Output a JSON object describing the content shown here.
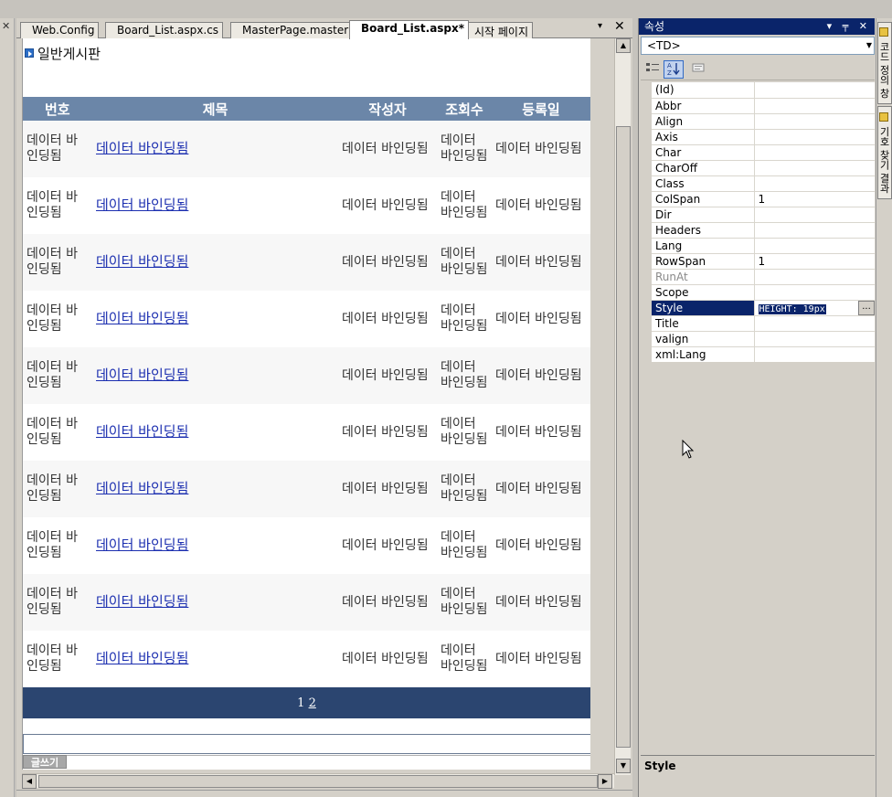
{
  "tabs": [
    {
      "label": "Web.Config",
      "active": false
    },
    {
      "label": "Board_List.aspx.cs",
      "active": false
    },
    {
      "label": "MasterPage.master",
      "active": false
    },
    {
      "label": "Board_List.aspx*",
      "active": true
    },
    {
      "label": "시작 페이지",
      "active": false
    }
  ],
  "tab_controls": {
    "dropdown": "▾",
    "close": "✕"
  },
  "left_strip": {
    "close": "✕"
  },
  "board": {
    "title": "일반게시판",
    "headers": [
      "번호",
      "제목",
      "작성자",
      "조회수",
      "등록일"
    ],
    "rows": [
      [
        "데이터 바인딩됨",
        "데이터 바인딩됨",
        "데이터 바인딩됨",
        "데이터 바인딩됨",
        "데이터 바인딩됨"
      ],
      [
        "데이터 바인딩됨",
        "데이터 바인딩됨",
        "데이터 바인딩됨",
        "데이터 바인딩됨",
        "데이터 바인딩됨"
      ],
      [
        "데이터 바인딩됨",
        "데이터 바인딩됨",
        "데이터 바인딩됨",
        "데이터 바인딩됨",
        "데이터 바인딩됨"
      ],
      [
        "데이터 바인딩됨",
        "데이터 바인딩됨",
        "데이터 바인딩됨",
        "데이터 바인딩됨",
        "데이터 바인딩됨"
      ],
      [
        "데이터 바인딩됨",
        "데이터 바인딩됨",
        "데이터 바인딩됨",
        "데이터 바인딩됨",
        "데이터 바인딩됨"
      ],
      [
        "데이터 바인딩됨",
        "데이터 바인딩됨",
        "데이터 바인딩됨",
        "데이터 바인딩됨",
        "데이터 바인딩됨"
      ],
      [
        "데이터 바인딩됨",
        "데이터 바인딩됨",
        "데이터 바인딩됨",
        "데이터 바인딩됨",
        "데이터 바인딩됨"
      ],
      [
        "데이터 바인딩됨",
        "데이터 바인딩됨",
        "데이터 바인딩됨",
        "데이터 바인딩됨",
        "데이터 바인딩됨"
      ],
      [
        "데이터 바인딩됨",
        "데이터 바인딩됨",
        "데이터 바인딩됨",
        "데이터 바인딩됨",
        "데이터 바인딩됨"
      ],
      [
        "데이터 바인딩됨",
        "데이터 바인딩됨",
        "데이터 바인딩됨",
        "데이터 바인딩됨",
        "데이터 바인딩됨"
      ]
    ],
    "pager": {
      "current": "1",
      "link": "2"
    },
    "write_button": "글쓰기"
  },
  "properties": {
    "header": "속성",
    "header_buttons": "▾ ╤ ✕",
    "object": "<TD>",
    "items": [
      {
        "name": "(Id)",
        "value": ""
      },
      {
        "name": "Abbr",
        "value": ""
      },
      {
        "name": "Align",
        "value": ""
      },
      {
        "name": "Axis",
        "value": ""
      },
      {
        "name": "Char",
        "value": ""
      },
      {
        "name": "CharOff",
        "value": ""
      },
      {
        "name": "Class",
        "value": ""
      },
      {
        "name": "ColSpan",
        "value": "1"
      },
      {
        "name": "Dir",
        "value": ""
      },
      {
        "name": "Headers",
        "value": ""
      },
      {
        "name": "Lang",
        "value": ""
      },
      {
        "name": "RowSpan",
        "value": "1"
      },
      {
        "name": "RunAt",
        "value": "",
        "disabled": true
      },
      {
        "name": "Scope",
        "value": ""
      },
      {
        "name": "Style",
        "value": "HEIGHT: 19px",
        "selected": true
      },
      {
        "name": "Title",
        "value": ""
      },
      {
        "name": "valign",
        "value": ""
      },
      {
        "name": "xml:Lang",
        "value": ""
      }
    ],
    "ellipsis": "...",
    "description_title": "Style"
  },
  "right_tabs": [
    {
      "label": "코드 정의 창",
      "icon": "code-definition-icon"
    },
    {
      "label": "기호 찾기 결과",
      "icon": "find-symbol-icon"
    }
  ],
  "colors": {
    "header_bg": "#6b86a8",
    "pager_bg": "#2b4570",
    "link": "#1c2fb0",
    "selection": "#0a246a"
  }
}
